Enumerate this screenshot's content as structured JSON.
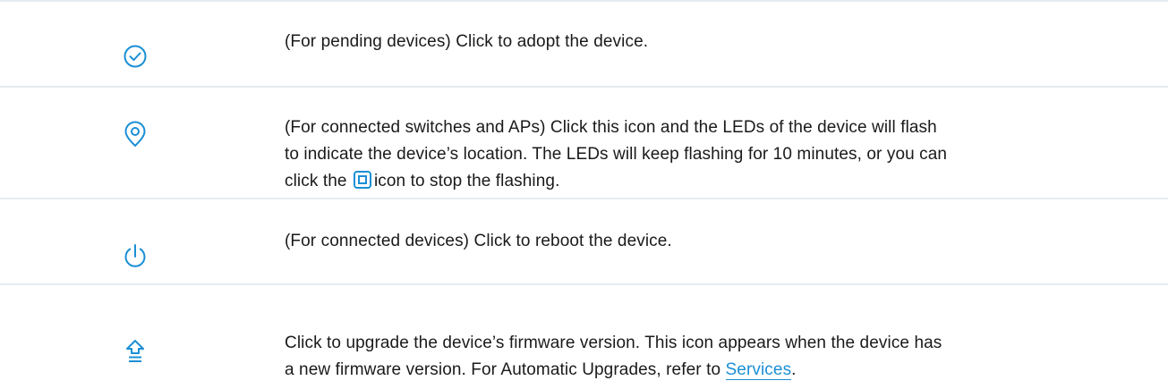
{
  "colors": {
    "accent": "#1a8fd6",
    "divider": "#e6ebf0",
    "text": "#1a1a1a"
  },
  "rows": [
    {
      "icon": "check-circle-icon",
      "text": "(For pending devices) Click to adopt the device."
    },
    {
      "icon": "locate-icon",
      "line1": "(For connected switches and APs) Click this icon and the LEDs of the device will flash",
      "line2": "to indicate the device’s location. The LEDs will keep flashing for 10 minutes, or you can",
      "line3_before": "click the",
      "inline_icon": "stop-square-icon",
      "line3_after": "icon to stop the flashing."
    },
    {
      "icon": "power-icon",
      "text": "(For connected devices) Click to reboot the device."
    },
    {
      "icon": "upgrade-icon",
      "line1": "Click to upgrade the device’s firmware version. This icon appears when the device has",
      "line2_before": "a new firmware version. For Automatic Upgrades, refer to",
      "link": "Services",
      "line2_after": "."
    }
  ]
}
